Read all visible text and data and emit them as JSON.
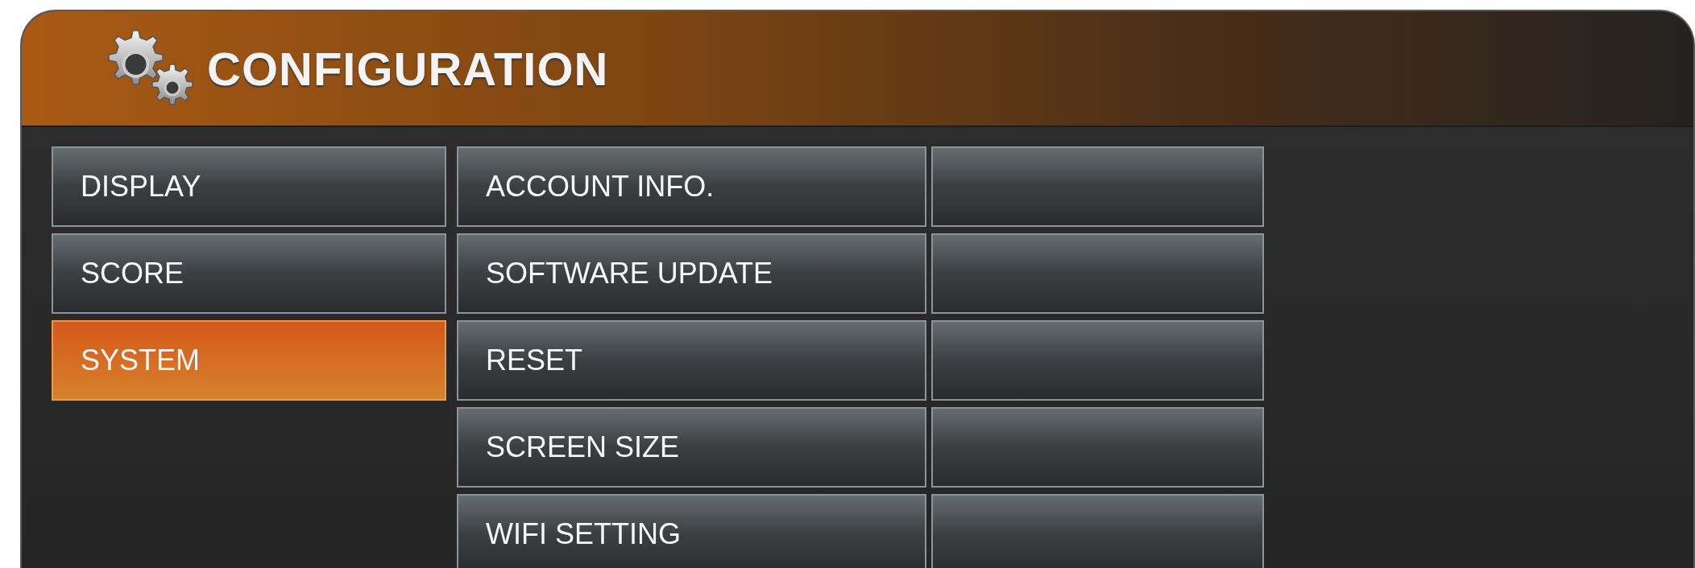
{
  "header": {
    "title": "CONFIGURATION"
  },
  "categories": [
    {
      "label": "DISPLAY",
      "selected": false
    },
    {
      "label": "SCORE",
      "selected": false
    },
    {
      "label": "SYSTEM",
      "selected": true
    }
  ],
  "options": [
    {
      "label": "ACCOUNT INFO."
    },
    {
      "label": "SOFTWARE UPDATE"
    },
    {
      "label": "RESET"
    },
    {
      "label": "SCREEN SIZE"
    },
    {
      "label": "WIFI SETTING"
    }
  ]
}
